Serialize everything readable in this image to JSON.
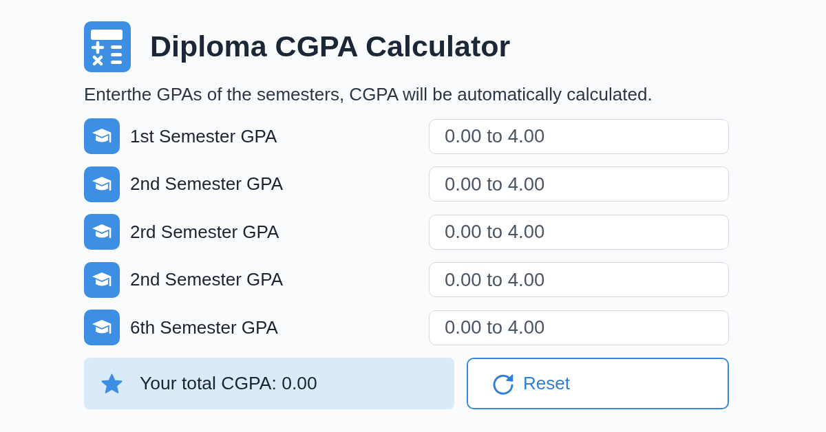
{
  "header": {
    "title": "Diploma CGPA Calculator",
    "subtitle": "Enterthe GPAs of the semesters, CGPA will be automatically calculated."
  },
  "semesters": [
    {
      "label": "1st Semester GPA",
      "placeholder": "0.00 to 4.00"
    },
    {
      "label": "2nd Semester GPA",
      "placeholder": "0.00 to 4.00"
    },
    {
      "label": "2rd Semester GPA",
      "placeholder": "0.00 to 4.00"
    },
    {
      "label": "2nd Semester GPA",
      "placeholder": "0.00 to 4.00"
    },
    {
      "label": "6th Semester GPA",
      "placeholder": "0.00 to 4.00"
    }
  ],
  "result": {
    "label": "Your total CGPA: 0.00"
  },
  "reset_button": {
    "label": "Reset"
  }
}
